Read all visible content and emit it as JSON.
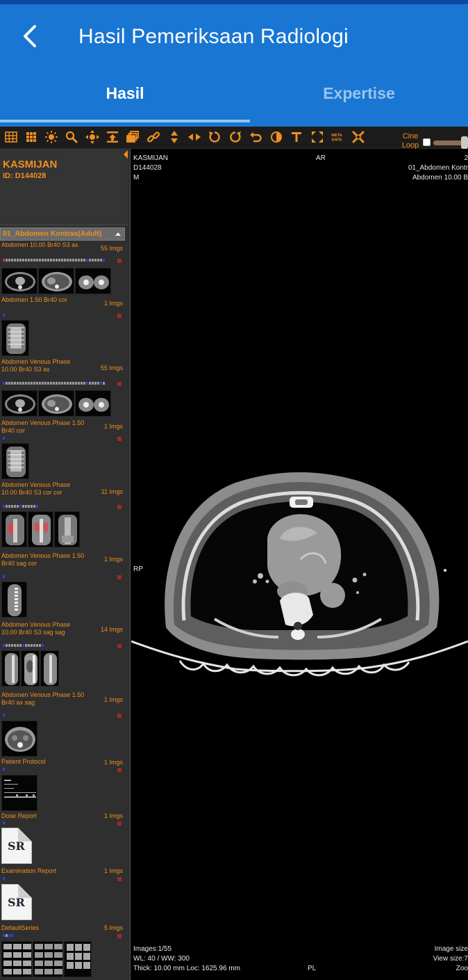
{
  "app": {
    "title": "Hasil Pemeriksaan Radiologi",
    "tabs": [
      {
        "label": "Hasil",
        "active": true
      },
      {
        "label": "Expertise",
        "active": false
      }
    ],
    "colors": {
      "appbar": "#1976d2",
      "accent": "#f0901e"
    }
  },
  "toolbar": {
    "icons": [
      "layout-grid-icon",
      "tile-grid-icon",
      "brightness-icon",
      "zoom-icon",
      "pan-icon",
      "stack-icon",
      "series-icon",
      "link-icon",
      "flip-vertical-icon",
      "flip-horizontal-icon",
      "rotate-left-icon",
      "rotate-right-icon",
      "undo-icon",
      "invert-icon",
      "text-icon",
      "fullscreen-icon",
      "metadata-icon",
      "reset-icon"
    ],
    "meta_label_top": "META",
    "meta_label_bottom": "DATA",
    "cine_label": "Cine Loop"
  },
  "patient": {
    "name": "KASMIJAN",
    "id": "ID: D144028"
  },
  "study": {
    "title": "01_Abdomen Kontras(Adult)",
    "series": [
      {
        "name": "Abdomen 10.00 Br40 S3 ax",
        "count": "55 Imgs"
      },
      {
        "name": "Abdomen 1.50 Br40 cor",
        "count": "1 Imgs"
      },
      {
        "name": "Abdomen Venous Phase 10.00 Br40 S3 ax",
        "count": "55 Imgs"
      },
      {
        "name": "Abdomen Venous Phase 1.50 Br40 cor",
        "count": "1 Imgs"
      },
      {
        "name": "Abdomen Venous Phase 10.00 Br40 S3 cor cor",
        "count": "11 Imgs"
      },
      {
        "name": "Abdomen Venous Phase 1.50 Br40 sag cor",
        "count": "1 Imgs"
      },
      {
        "name": "Abdomen Venous Phase 10.00 Br40 S3 sag sag",
        "count": "14 Imgs"
      },
      {
        "name": "Abdomen Venous Phase 1.50 Br40 ax sag",
        "count": "1 Imgs"
      },
      {
        "name": "Patient Protocol",
        "count": "1 Imgs"
      },
      {
        "name": "Dose Report",
        "count": "1 Imgs"
      },
      {
        "name": "Examination Report",
        "count": "1 Imgs"
      },
      {
        "name": "DefaultSeries",
        "count": "5 Imgs"
      }
    ],
    "sr_label": "SR"
  },
  "viewer": {
    "top_left": [
      "KASMIJAN",
      "D144028",
      "M"
    ],
    "top_center": "AR",
    "top_right": [
      "2",
      "01_Abdomen Kontr",
      "Abdomen 10.00 B"
    ],
    "left_mid": "RP",
    "bottom_left": [
      "Images:1/55",
      "WL: 40 / WW: 300",
      "Thick: 10.00 mm Loc: 1625.96 mm"
    ],
    "bottom_center": "PL",
    "bottom_right": [
      "Image size",
      "View size:7",
      "Zoo"
    ]
  }
}
